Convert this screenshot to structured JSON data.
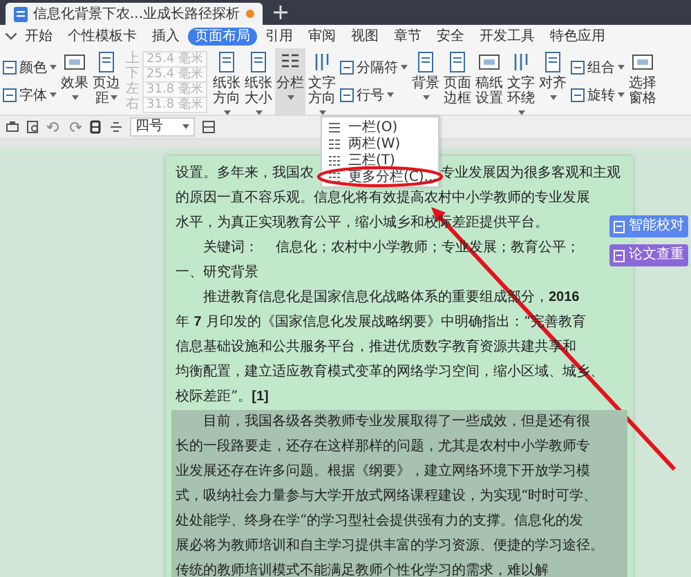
{
  "document_tab": {
    "title": "信息化背景下农...业成长路径探析",
    "unsaved": true
  },
  "menu": [
    {
      "label": "开始",
      "selected": false
    },
    {
      "label": "个性模板卡",
      "selected": false
    },
    {
      "label": "插入",
      "selected": false
    },
    {
      "label": "页面布局",
      "selected": true
    },
    {
      "label": "引用",
      "selected": false
    },
    {
      "label": "审阅",
      "selected": false
    },
    {
      "label": "视图",
      "selected": false
    },
    {
      "label": "章节",
      "selected": false
    },
    {
      "label": "安全",
      "selected": false
    },
    {
      "label": "开发工具",
      "selected": false
    },
    {
      "label": "特色应用",
      "selected": false
    }
  ],
  "ribbon": [
    {
      "kind": "stack",
      "items": [
        {
          "label": "颜色",
          "dropdown": true
        },
        {
          "label": "字体",
          "dropdown": true
        }
      ]
    },
    {
      "kind": "big",
      "label": "效果",
      "dropdown": true,
      "pressed": false
    },
    {
      "kind": "big",
      "label": "页边距",
      "dropdown": true,
      "pressed": false
    },
    {
      "kind": "margins",
      "fields": [
        {
          "label": "上",
          "value": "25.4 毫米",
          "disabled": true
        },
        {
          "label": "下",
          "value": "25.4 毫米",
          "disabled": true
        },
        {
          "label": "左",
          "value": "31.8 毫米",
          "disabled": true
        },
        {
          "label": "右",
          "value": "31.8 毫米",
          "disabled": true
        }
      ]
    },
    {
      "kind": "big",
      "label": "纸张方向",
      "dropdown": true,
      "pressed": false
    },
    {
      "kind": "big",
      "label": "纸张大小",
      "dropdown": true,
      "pressed": false
    },
    {
      "kind": "big",
      "label": "分栏",
      "dropdown": true,
      "pressed": true
    },
    {
      "kind": "big",
      "label": "文字方向",
      "dropdown": true,
      "pressed": false
    },
    {
      "kind": "stack",
      "items": [
        {
          "label": "分隔符",
          "dropdown": true
        },
        {
          "label": "行号",
          "dropdown": true
        }
      ]
    },
    {
      "kind": "big",
      "label": "背景",
      "dropdown": true,
      "pressed": false
    },
    {
      "kind": "big",
      "label": "页面边框",
      "dropdown": false,
      "pressed": false
    },
    {
      "kind": "big",
      "label": "稿纸设置",
      "dropdown": false,
      "pressed": false
    },
    {
      "kind": "big",
      "label": "文字环绕",
      "dropdown": true,
      "pressed": false
    },
    {
      "kind": "big",
      "label": "对齐",
      "dropdown": true,
      "pressed": false
    },
    {
      "kind": "stack",
      "items": [
        {
          "label": "组合",
          "dropdown": true
        },
        {
          "label": "旋转",
          "dropdown": true
        }
      ]
    },
    {
      "kind": "big",
      "label": "选择窗格",
      "dropdown": false,
      "pressed": false
    }
  ],
  "toolbar": {
    "font_size": "四号"
  },
  "column_menu": [
    {
      "label": "一栏(O)"
    },
    {
      "label": "两栏(W)"
    },
    {
      "label": "三栏(T)"
    },
    {
      "label": "更多分栏(C)..."
    }
  ],
  "document": [
    {
      "indent": false,
      "selected": false,
      "lines": [
        [
          "设置。多年来，我国农",
          "专业发展因为很多客观和主观"
        ],
        [
          "的原因一直不容乐观。信息化将有效提高农村中小学教师的专业发展"
        ],
        [
          "水平，为真正实现教育公平，缩小城乡和校际差距提供平台。"
        ]
      ]
    },
    {
      "indent": true,
      "selected": false,
      "lines": [
        [
          "关键词：    信息化；农村中小学教师；专业发展；教育公平；"
        ]
      ]
    },
    {
      "indent": false,
      "selected": false,
      "lines": [
        [
          "一、研究背景"
        ]
      ]
    },
    {
      "indent": true,
      "selected": false,
      "lines": [
        [
          "推进教育信息化是国家信息化战略体系的重要组成部分，**2016**"
        ],
        [
          "年 **7** 月印发的《国家信息化发展战略纲要》中明确指出：“完善教育"
        ],
        [
          "信息基础设施和公共服务平台，推进优质数字教育资源共建共享和"
        ],
        [
          "均衡配置，建立适应教育模式变革的网络学习空间，缩小区域、城乡、"
        ],
        [
          "校际差距”。**[1]**"
        ]
      ]
    },
    {
      "indent": true,
      "selected": true,
      "lines": [
        [
          "目前，我国各级各类教师专业发展取得了一些成效，但是还有很"
        ],
        [
          "长的一段路要走，还存在这样那样的问题，尤其是农村中小学教师专"
        ],
        [
          "业发展还存在许多问题。根据《纲要》，建立网络环境下开放学习模"
        ],
        [
          "式，吸纳社会力量参与大学开放式网络课程建设，为实现“时时可学、"
        ],
        [
          "处处能学、终身在学”的学习型社会提供强有力的支撑。信息化的发"
        ],
        [
          "展必将为教师培训和自主学习提供丰富的学习资源、便捷的学习途径。"
        ],
        [
          "传统的教师培训模式不能满足教师个性化学习的需求，难以解"
        ]
      ]
    }
  ],
  "side_buttons": [
    {
      "label": "智能校对",
      "color": "#5b86ee"
    },
    {
      "label": "论文查重",
      "color": "#8b67d9"
    }
  ]
}
